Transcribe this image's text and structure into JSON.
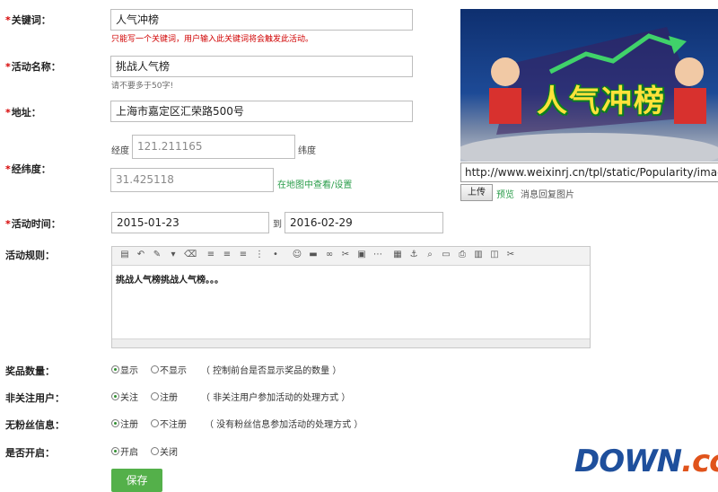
{
  "form": {
    "keyword": {
      "label": "关键词：",
      "value": "人气冲榜",
      "hint": "只能写一个关键词，用户输入此关键词将会触发此活动。"
    },
    "activity_name": {
      "label": "活动名称：",
      "value": "挑战人气榜",
      "hint": "请不要多于50字!"
    },
    "address": {
      "label": "地址：",
      "value": "上海市嘉定区汇荣路500号"
    },
    "coords": {
      "label": "经纬度：",
      "lng_label": "经度",
      "lng_value": "121.211165",
      "lat_label": "纬度",
      "lat_value": "31.425118",
      "map_link": "在地图中查看/设置"
    },
    "time": {
      "label": "活动时间：",
      "start": "2015-01-23",
      "to": "到",
      "end": "2016-02-29"
    },
    "rules": {
      "label": "活动规则：",
      "content": "挑战人气榜挑战人气榜。。。"
    },
    "prize_count": {
      "label": "奖品数量：",
      "opt1": "显示",
      "opt2": "不显示",
      "note": "（ 控制前台是否显示奖品的数量 ）",
      "selected": "显示"
    },
    "non_follow": {
      "label": "非关注用户：",
      "opt1": "关注",
      "opt2": "注册",
      "note": "（ 非关注用户参加活动的处理方式 ）",
      "selected": "关注"
    },
    "no_fans": {
      "label": "无粉丝信息：",
      "opt1": "注册",
      "opt2": "不注册",
      "note": "（ 没有粉丝信息参加活动的处理方式 ）",
      "selected": "注册"
    },
    "enabled": {
      "label": "是否开启：",
      "opt1": "开启",
      "opt2": "关闭",
      "selected": "开启"
    },
    "save_label": "保存"
  },
  "image_panel": {
    "banner_text": "人气冲榜",
    "url": "http://www.weixinrj.cn/tpl/static/Popularity/images",
    "upload_label": "上传",
    "preview_label": "预览",
    "reply_image_label": "消息回复图片"
  },
  "watermark": {
    "main": "DOWN",
    "suffix": ".cc"
  },
  "colors": {
    "required": "#d60000",
    "link": "#2a9d4a",
    "save": "#54b04a",
    "banner_text": "#ffe23a"
  }
}
